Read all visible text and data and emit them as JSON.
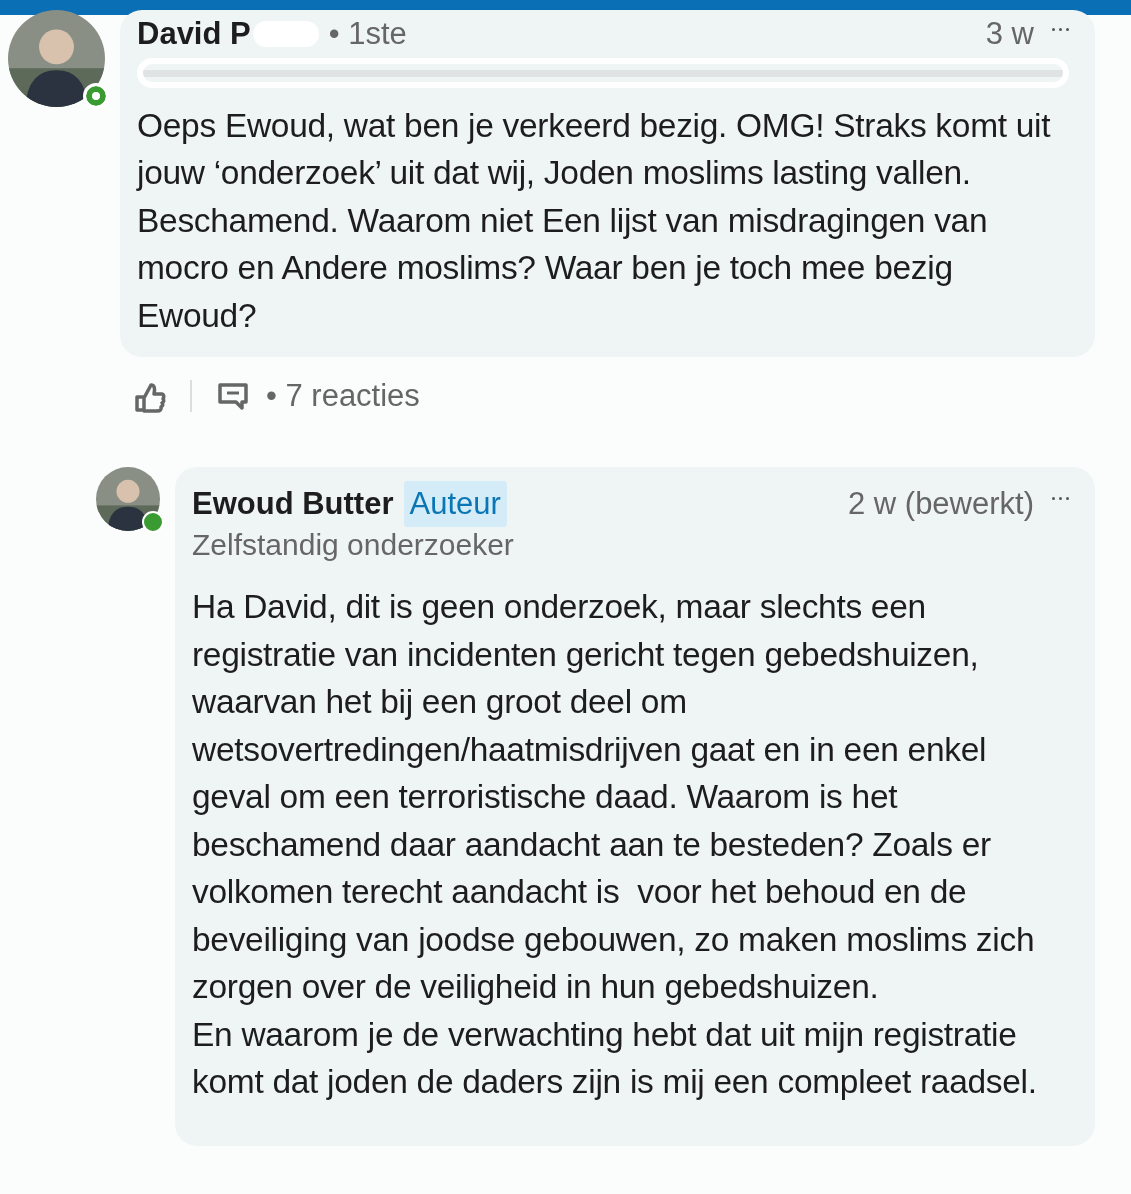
{
  "comments": [
    {
      "kind": "comment",
      "author": "David P",
      "degree": "• 1ste",
      "time": "3 w",
      "headline_redacted": true,
      "presence": {
        "kind": "ring"
      },
      "paragraphs": [
        "Oeps Ewoud, wat ben je verkeerd bezig. OMG! Straks komt uit jouw ‘onderzoek’ uit dat wij, Joden moslims lasting vallen. Beschamend. Waarom niet Een lijst van misdragingen van mocro en Andere moslims? Waar ben je toch mee bezig Ewoud?"
      ],
      "reactions": "• 7 reacties"
    },
    {
      "kind": "reply",
      "author": "Ewoud Butter",
      "badge": "Auteur",
      "time": "2 w (bewerkt)",
      "headline": "Zelfstandig onderzoeker",
      "presence": {
        "kind": "dot"
      },
      "paragraphs": [
        "Ha David, dit is geen onderzoek, maar slechts een registratie van incidenten gericht tegen gebedshuizen, waarvan het bij een groot deel om wetsovertredingen/haatmisdrijven gaat en in een enkel geval om een terroristische daad. Waarom is het beschamend daar aandacht aan te besteden? Zoals er volkomen terecht aandacht is  voor het behoud en de beveiliging van joodse gebouwen, zo maken moslims zich zorgen over de veiligheid in hun gebedshuizen.",
        "En waarom je de verwachting hebt dat uit mijn registratie komt dat joden de daders zijn is mij een compleet raadsel."
      ]
    }
  ]
}
